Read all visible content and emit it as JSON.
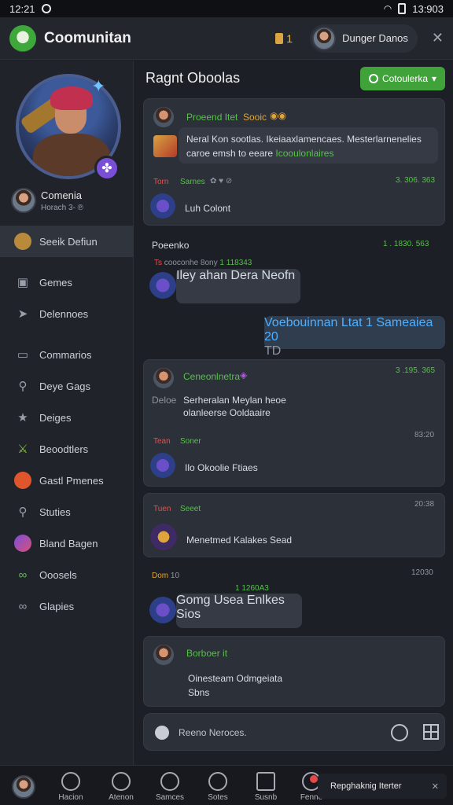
{
  "status": {
    "time": "12:21",
    "right": "13:903"
  },
  "app": {
    "title": "Coomunitan",
    "rec_label": "1",
    "user_name": "Dunger Danos"
  },
  "sidebar": {
    "profile_name": "Comenia",
    "profile_sub": "Horach 3- ℗",
    "items": [
      {
        "label": "Seeik Defiun",
        "icon": "avatar-icon"
      },
      {
        "label": "Gemes",
        "icon": "games-icon"
      },
      {
        "label": "Delennoes",
        "icon": "arrow-icon"
      },
      {
        "label": "Commarios",
        "icon": "chat-icon"
      },
      {
        "label": "Deye Gags",
        "icon": "search-icon"
      },
      {
        "label": "Deiges",
        "icon": "star-icon"
      },
      {
        "label": "Beoodtlers",
        "icon": "sword-icon"
      },
      {
        "label": "Gastl Pmenes",
        "icon": "fire-icon"
      },
      {
        "label": "Stuties",
        "icon": "search-icon"
      },
      {
        "label": "Bland Bagen",
        "icon": "planet-icon"
      },
      {
        "label": "Ooosels",
        "icon": "link-icon"
      },
      {
        "label": "Glapies",
        "icon": "link-icon"
      }
    ]
  },
  "main": {
    "title": "Ragnt Oboolas",
    "create_label": "Cotoulerka",
    "card1": {
      "head": "Proeend Itet",
      "tag": "Sooic",
      "text1": "Neral Kon sootlas. Ikeiaaxlamencaes. Mesterlarnenelies",
      "text2": "caroe emsh to eeare",
      "text2_link": "Icooulonlaires",
      "sub_red": "Torn",
      "sub_green": "Sarnes",
      "sub_time": "3. 306. 363",
      "reply": "Luh Colont"
    },
    "section": {
      "name": "Poeenko",
      "meta_red": "Ts",
      "meta_muted": "cooconhe 8ony",
      "meta_time": "1 . 1830. 563",
      "meta_green": "1 118343",
      "bubble": "Iley ahan Dera Neofn"
    },
    "outgoing": {
      "text": "Voebouinnan Ltat 1 Sameaiea 20",
      "tag": "TD"
    },
    "card2": {
      "head": "Ceneonlnetra",
      "time": "3 .195. 365",
      "user": "Deloe",
      "text1": "Serheralan Meylan heoe",
      "text2": "olanleerse Ooldaaire",
      "sub_red": "Tean",
      "sub_green": "Soner",
      "sub_time": "83:20",
      "reply": "Ilo Okoolie Ftiaes"
    },
    "card3": {
      "red": "Tuen",
      "green": "Seeet",
      "time": "20:38",
      "text": "Menetmed Kalakes Sead"
    },
    "section2": {
      "orange": "Dom",
      "muted": "10",
      "time": "12030",
      "green": "1 1260A3",
      "bubble": "Gomg Usea Enlkes Sios"
    },
    "card4": {
      "head": "Borboer it",
      "text1": "Oinesteam Odmgeiata",
      "text2": "Sbns"
    },
    "composer": {
      "placeholder": "Reeno Neroces."
    }
  },
  "bottom": {
    "items": [
      "Hacion",
      "Atenon",
      "Samces",
      "Sotes",
      "Susnb",
      "Fenne"
    ],
    "toast": "Repghaknig Iterter"
  }
}
